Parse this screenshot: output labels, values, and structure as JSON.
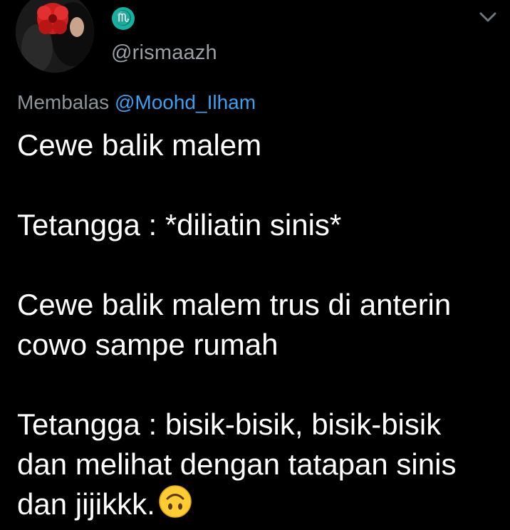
{
  "profile": {
    "avatar_icon": "avatar-photo-red-flower",
    "name_badge_glyph": "♏",
    "name_badge_color": "#12b3a0",
    "handle": "@rismaazh",
    "menu_icon": "chevron-down-icon"
  },
  "reply": {
    "prefix": "Membalas",
    "mention": "@Moohd_Ilham",
    "mention_color": "#3aa0f2"
  },
  "tweet": {
    "lines": [
      "Cewe balik malem",
      "",
      "Tetangga : *diliatin sinis*",
      "",
      "Cewe balik malem trus di anterin",
      "cowo sampe rumah",
      "",
      "Tetangga : bisik-bisik, bisik-bisik",
      "dan melihat dengan tatapan sinis",
      "dan jijikkk."
    ],
    "trailing_emoji": "upside-down-face-emoji"
  },
  "colors": {
    "background": "#000000",
    "text": "#ffffff",
    "secondary": "#8f9499"
  }
}
